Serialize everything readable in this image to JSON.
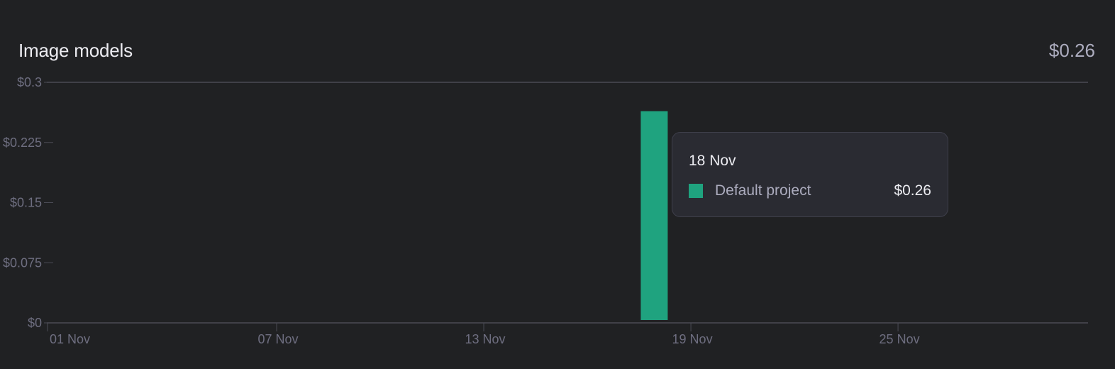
{
  "header": {
    "title": "Image models",
    "total": "$0.26"
  },
  "tooltip": {
    "date": "18 Nov",
    "series_label": "Default project",
    "value": "$0.26"
  },
  "colors": {
    "bar": "#1fa37f",
    "grid": "#4a4b55",
    "tick_text": "#6e6e80",
    "axis": "#4a4b55"
  },
  "chart_data": {
    "type": "bar",
    "title": "Image models",
    "ylim": [
      0,
      0.3
    ],
    "y_ticks": [
      0,
      0.075,
      0.15,
      0.225,
      0.3
    ],
    "y_tick_labels": [
      "$0",
      "$0.075",
      "$0.15",
      "$0.225",
      "$0.3"
    ],
    "x_tick_labels": [
      "01 Nov",
      "07 Nov",
      "13 Nov",
      "19 Nov",
      "25 Nov"
    ],
    "x_tick_days": [
      1,
      7,
      13,
      19,
      25
    ],
    "x_range_days": [
      1,
      30
    ],
    "series": [
      {
        "name": "Default project",
        "points": [
          {
            "day": 18,
            "value": 0.264
          }
        ]
      }
    ],
    "grid": "top line only",
    "legend": "tooltip"
  }
}
